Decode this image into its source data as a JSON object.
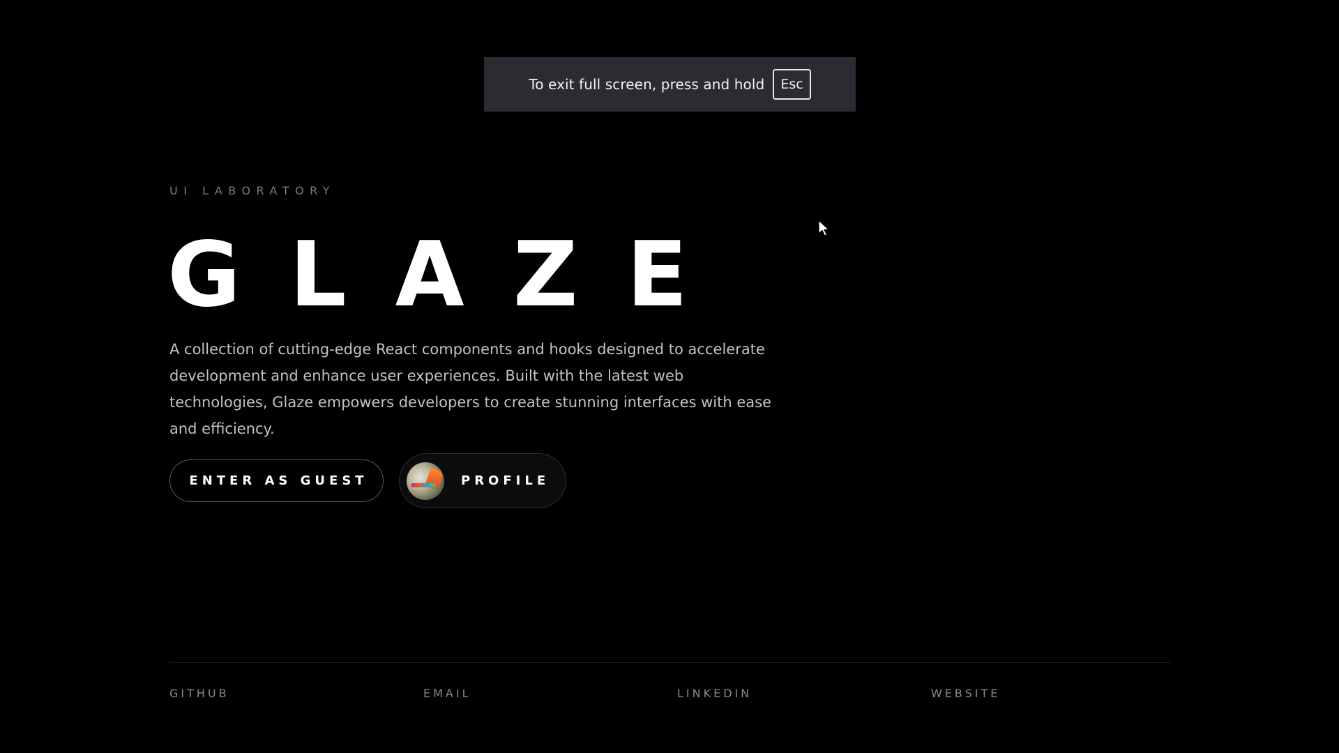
{
  "fullscreen_notice": {
    "text": "To exit full screen, press and hold",
    "key": "Esc"
  },
  "hero": {
    "eyebrow": "UI LABORATORY",
    "title": "GLAZE",
    "description": "A collection of cutting-edge React components and hooks designed to accelerate development and enhance user experiences. Built with the latest web technologies, Glaze empowers developers to create stunning interfaces with ease and efficiency."
  },
  "actions": {
    "guest_label": "ENTER AS GUEST",
    "profile_label": "PROFILE"
  },
  "footer": {
    "links": [
      "GITHUB",
      "EMAIL",
      "LINKEDIN",
      "WEBSITE"
    ]
  },
  "colors": {
    "background": "#000000",
    "notice_bg": "#2b2c31",
    "text_primary": "#ffffff",
    "text_muted": "#8a8a8a",
    "description": "#c3c3c3"
  },
  "icons": {
    "cursor": "mouse-pointer-icon",
    "avatar": "user-avatar"
  }
}
